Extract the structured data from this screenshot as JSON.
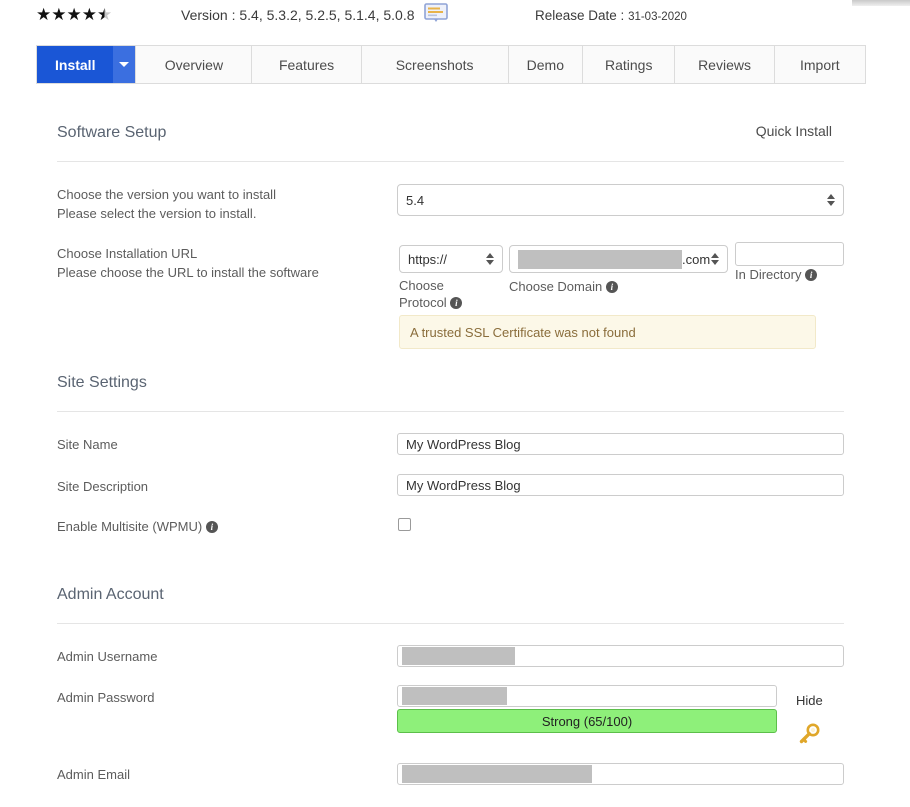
{
  "header": {
    "rating_stars": "★★★★",
    "rating_half_star": "★",
    "version_label": "Version : ",
    "version_values": "5.4, 5.3.2, 5.2.5, 5.1.4, 5.0.8",
    "changelog_icon": "changelog-icon",
    "release_label": "Release Date : ",
    "release_date": "31-03-2020"
  },
  "tabs": [
    {
      "label": "Install",
      "active": true
    },
    {
      "label": "Overview",
      "active": false
    },
    {
      "label": "Features",
      "active": false
    },
    {
      "label": "Screenshots",
      "active": false
    },
    {
      "label": "Demo",
      "active": false
    },
    {
      "label": "Ratings",
      "active": false
    },
    {
      "label": "Reviews",
      "active": false
    },
    {
      "label": "Import",
      "active": false
    }
  ],
  "software_setup": {
    "title": "Software Setup",
    "quick_install": "Quick Install",
    "version_label": "Choose the version you want to install",
    "version_sub": "Please select the version to install.",
    "version_value": "5.4",
    "url_label": "Choose Installation URL",
    "url_sub": "Please choose the URL to install the software",
    "protocol_value": "https://",
    "protocol_caption": "Choose Protocol",
    "domain_suffix": ".com",
    "domain_caption": "Choose Domain",
    "directory_value": "",
    "directory_caption": "In Directory",
    "ssl_warning": "A trusted SSL Certificate was not found"
  },
  "site_settings": {
    "title": "Site Settings",
    "site_name_label": "Site Name",
    "site_name_value": "My WordPress Blog",
    "site_desc_label": "Site Description",
    "site_desc_value": "My WordPress Blog",
    "multisite_label": "Enable Multisite (WPMU)",
    "multisite_checked": false
  },
  "admin_account": {
    "title": "Admin Account",
    "username_label": "Admin Username",
    "username_value": "",
    "password_label": "Admin Password",
    "password_value": "",
    "hide_label": "Hide",
    "key_icon": "key-icon",
    "strength_text": "Strong (65/100)",
    "strength_score": 65,
    "strength_max": 100,
    "strength_color": "#8ef07a",
    "email_label": "Admin Email",
    "email_value": ""
  },
  "colors": {
    "accent": "#1a56d6",
    "accent_light": "#3b6fe0",
    "warning_bg": "#fcf8e8",
    "warning_text": "#8a6d3b",
    "strength_green": "#8ef07a"
  }
}
